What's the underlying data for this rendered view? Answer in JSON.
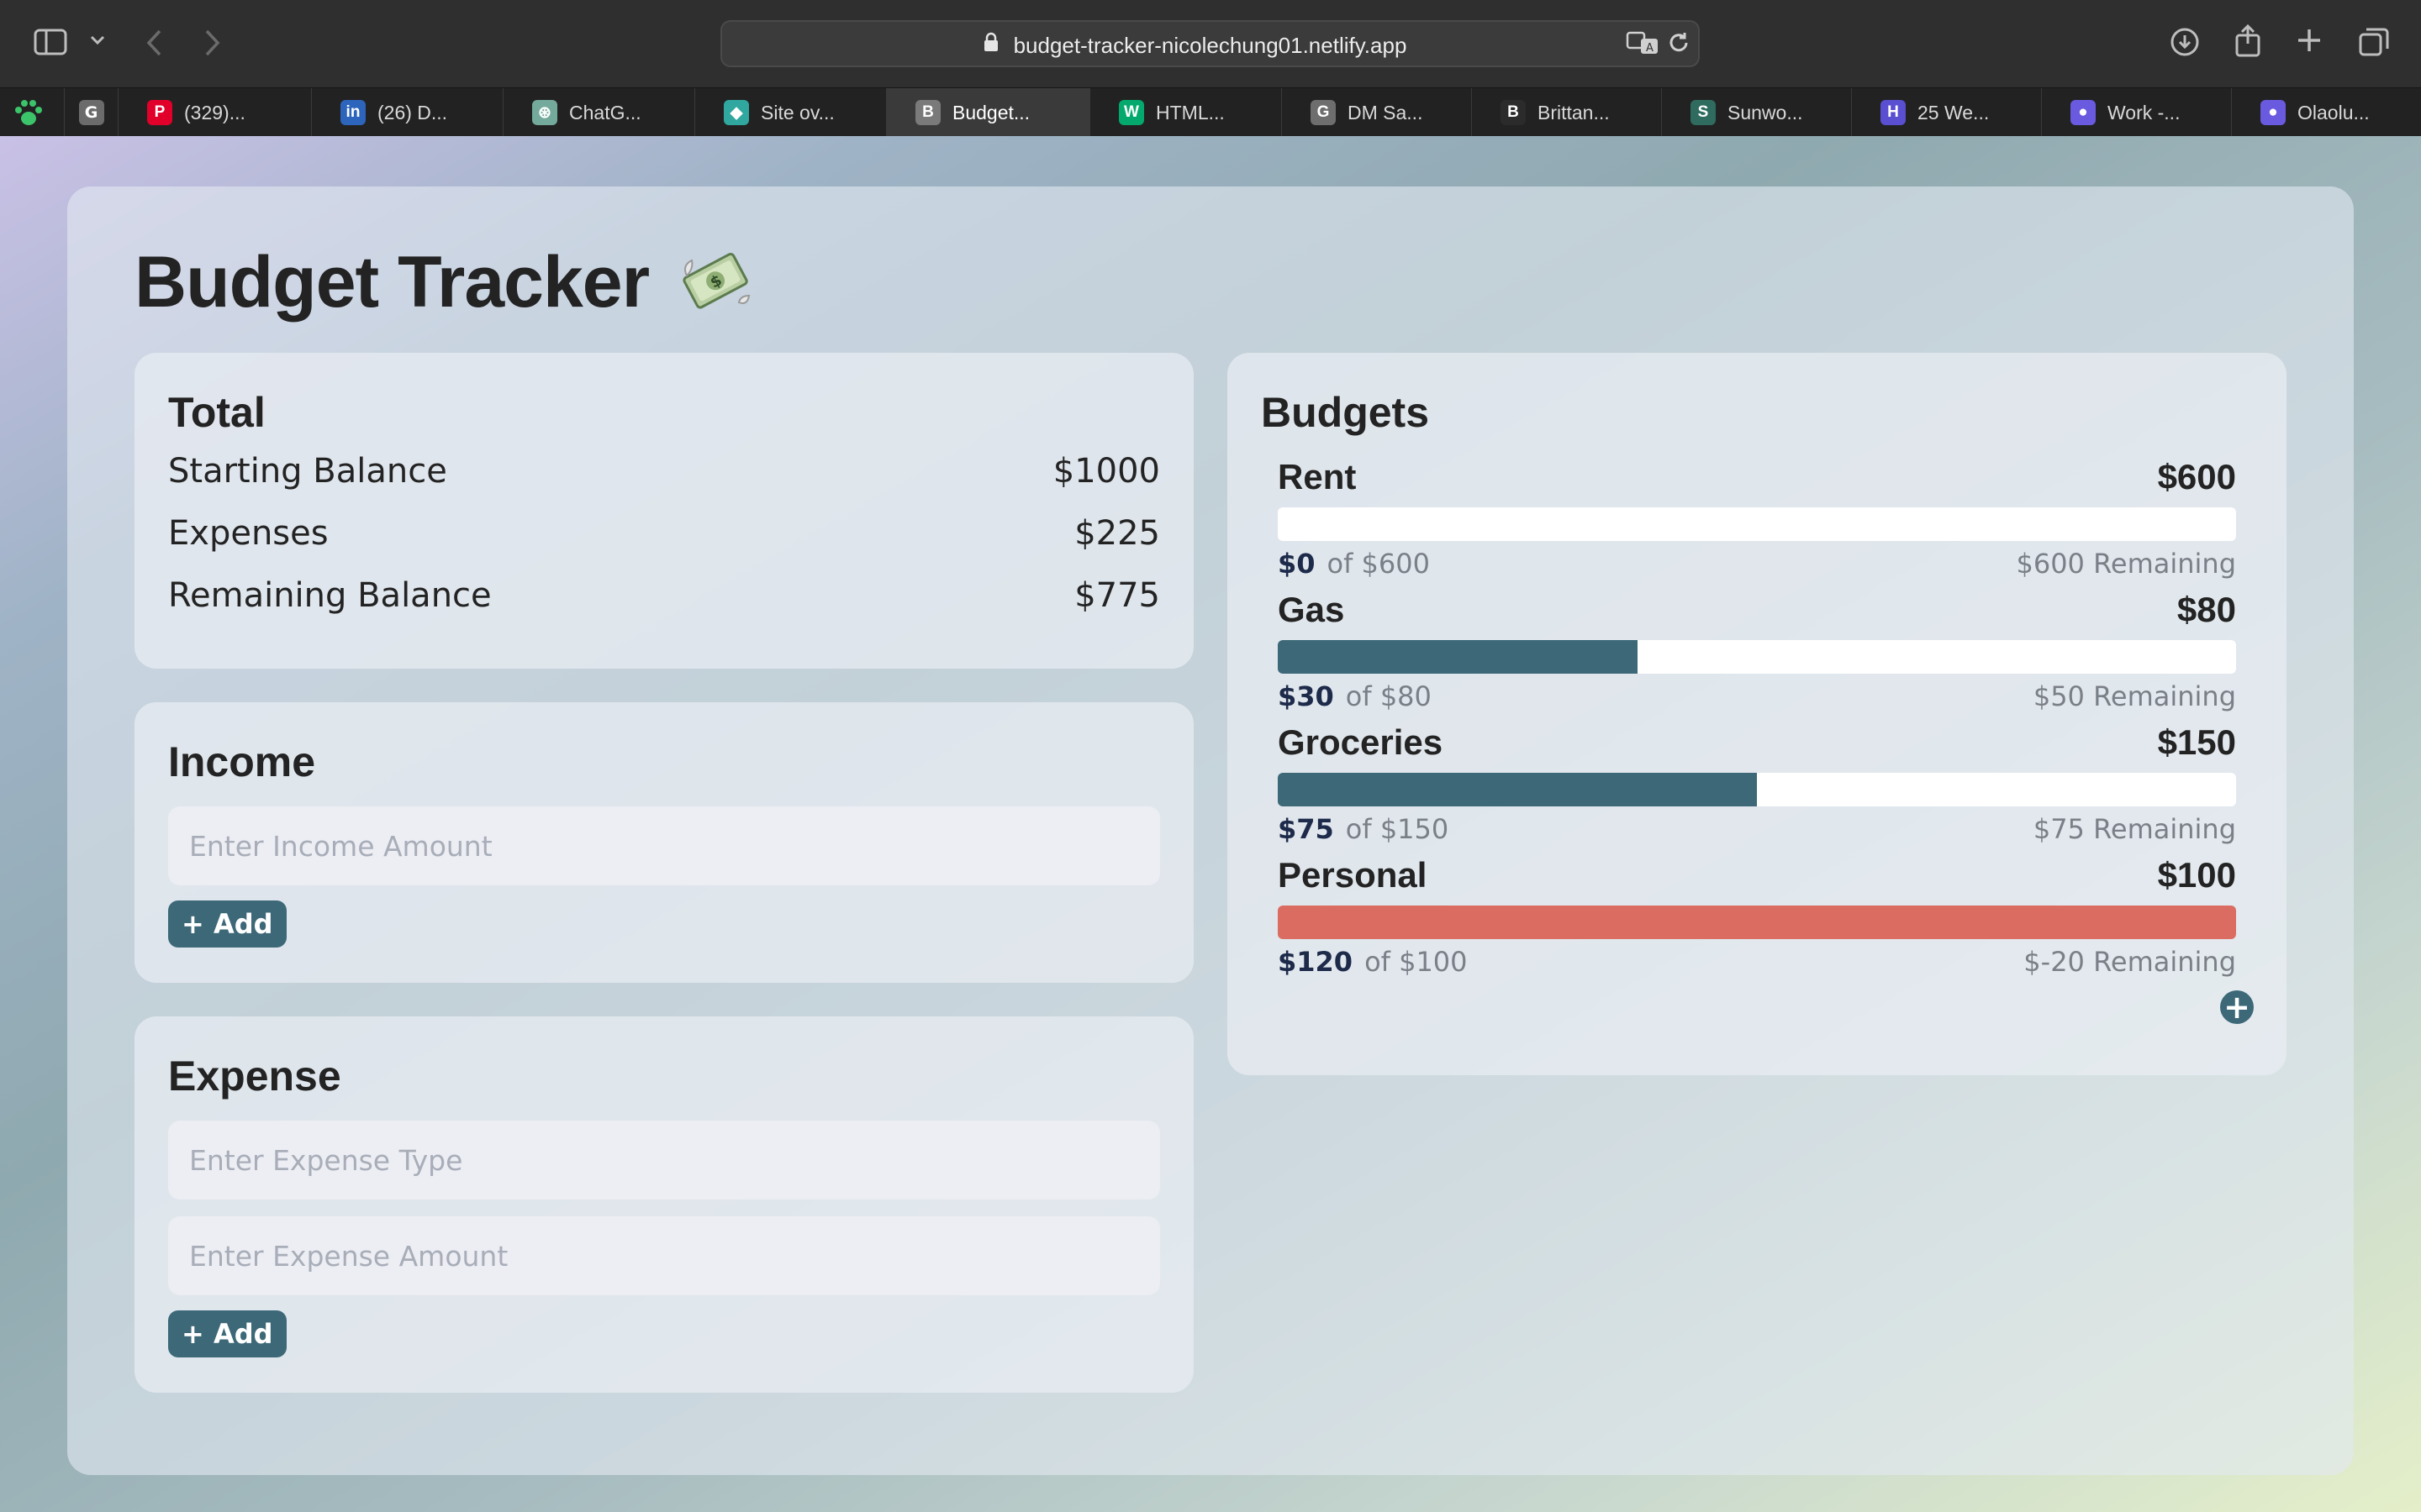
{
  "browser": {
    "url": "budget-tracker-nicolechung01.netlify.app",
    "tabs": [
      {
        "label": "(329)...",
        "favicon": "pinterest-icon",
        "color": "#e0002a",
        "glyph": "P"
      },
      {
        "label": "(26) D...",
        "favicon": "linkedin-icon",
        "color": "#2d64bc",
        "glyph": "in"
      },
      {
        "label": "ChatG...",
        "favicon": "chatgpt-icon",
        "color": "#74aa9c",
        "glyph": "⊛"
      },
      {
        "label": "Site ov...",
        "favicon": "netlify-icon",
        "color": "#30a79f",
        "glyph": "◆"
      },
      {
        "label": "Budget...",
        "favicon": "budget-icon",
        "color": "#7a7a7a",
        "glyph": "B"
      },
      {
        "label": "HTML...",
        "favicon": "w3schools-icon",
        "color": "#04aa6d",
        "glyph": "W"
      },
      {
        "label": "DM Sa...",
        "favicon": "google-fonts-icon",
        "color": "#6e6e6e",
        "glyph": "G"
      },
      {
        "label": "Brittan...",
        "favicon": "behance-icon",
        "color": "#2b2b2b",
        "glyph": "B"
      },
      {
        "label": "Sunwo...",
        "favicon": "sunwoo-icon",
        "color": "#2f6c5f",
        "glyph": "S"
      },
      {
        "label": "25 We...",
        "favicon": "web-icon",
        "color": "#5a4fd1",
        "glyph": "H"
      },
      {
        "label": "Work -...",
        "favicon": "work-pin-icon",
        "color": "#6a5ae0",
        "glyph": "●"
      },
      {
        "label": "Olaolu...",
        "favicon": "olaolu-pin-icon",
        "color": "#6a5ae0",
        "glyph": "●"
      }
    ]
  },
  "app": {
    "title": "Budget Tracker",
    "title_emoji": "money-with-wings-icon"
  },
  "total": {
    "title": "Total",
    "rows": [
      {
        "label": "Starting Balance",
        "value": "$1000"
      },
      {
        "label": "Expenses",
        "value": "$225"
      },
      {
        "label": "Remaining Balance",
        "value": "$775"
      }
    ]
  },
  "income": {
    "title": "Income",
    "amount_placeholder": "Enter Income Amount",
    "add_label": "+ Add"
  },
  "expense": {
    "title": "Expense",
    "type_placeholder": "Enter Expense Type",
    "amount_placeholder": "Enter Expense Amount",
    "add_label": "+ Add"
  },
  "budgets": {
    "title": "Budgets",
    "items": [
      {
        "name": "Rent",
        "limit": "$600",
        "spent": "$0",
        "of": "of $600",
        "remaining": "$600 Remaining",
        "progress": 0.0,
        "over": false
      },
      {
        "name": "Gas",
        "limit": "$80",
        "spent": "$30",
        "of": "of $80",
        "remaining": "$50 Remaining",
        "progress": 0.375,
        "over": false
      },
      {
        "name": "Groceries",
        "limit": "$150",
        "spent": "$75",
        "of": "of $150",
        "remaining": "$75 Remaining",
        "progress": 0.5,
        "over": false
      },
      {
        "name": "Personal",
        "limit": "$100",
        "spent": "$120",
        "of": "of $100",
        "remaining": "$-20 Remaining",
        "progress": 1.0,
        "over": true
      }
    ],
    "add_icon": "plus-circle-icon"
  },
  "colors": {
    "accent": "#3c6878",
    "over_budget": "#da6c61"
  }
}
